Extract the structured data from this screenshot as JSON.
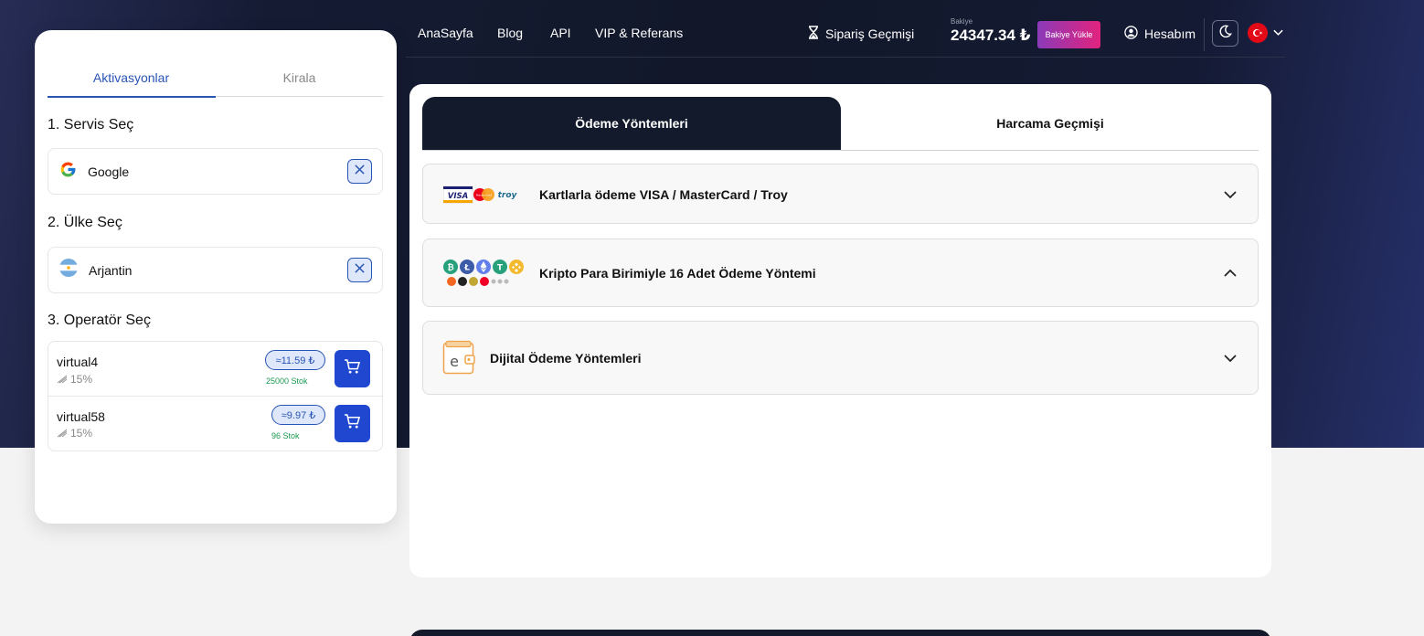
{
  "nav": {
    "links": [
      "AnaSayfa",
      "Blog",
      "API",
      "VIP & Referans"
    ],
    "order_history": "Sipariş Geçmişi",
    "balance_label": "Bakiye",
    "balance_amount": "24347.34 ₺",
    "topup_label": "Bakiye Yükle",
    "account_label": "Hesabım"
  },
  "left_panel": {
    "tabs": [
      "Aktivasyonlar",
      "Kirala"
    ],
    "step1": "1. Servis Seç",
    "service": "Google",
    "step2": "2. Ülke Seç",
    "country": "Arjantin",
    "step3": "3. Operatör Seç",
    "operators": [
      {
        "name": "virtual4",
        "discount": "15%",
        "price": "≈11.59 ₺",
        "stock": "25000 Stok"
      },
      {
        "name": "virtual58",
        "discount": "15%",
        "price": "≈9.97 ₺",
        "stock": "96 Stok"
      }
    ]
  },
  "main_panel": {
    "tabs": [
      "Ödeme Yöntemleri",
      "Harcama Geçmişi"
    ],
    "methods": [
      {
        "title": "Kartlarla ödeme VISA / MasterCard / Troy",
        "card_logos": [
          "VISA",
          "MasterCard",
          "troy"
        ],
        "expanded": false
      },
      {
        "title": "Kripto Para Birimiyle 16 Adet Ödeme Yöntemi",
        "expanded": true
      },
      {
        "title": "Dijital Ödeme Yöntemleri",
        "expanded": false
      }
    ]
  },
  "colors": {
    "accent": "#2854b5",
    "cart_button": "#1f47d0",
    "nav_bg": "#121829",
    "stock_green": "#1a9a52"
  }
}
